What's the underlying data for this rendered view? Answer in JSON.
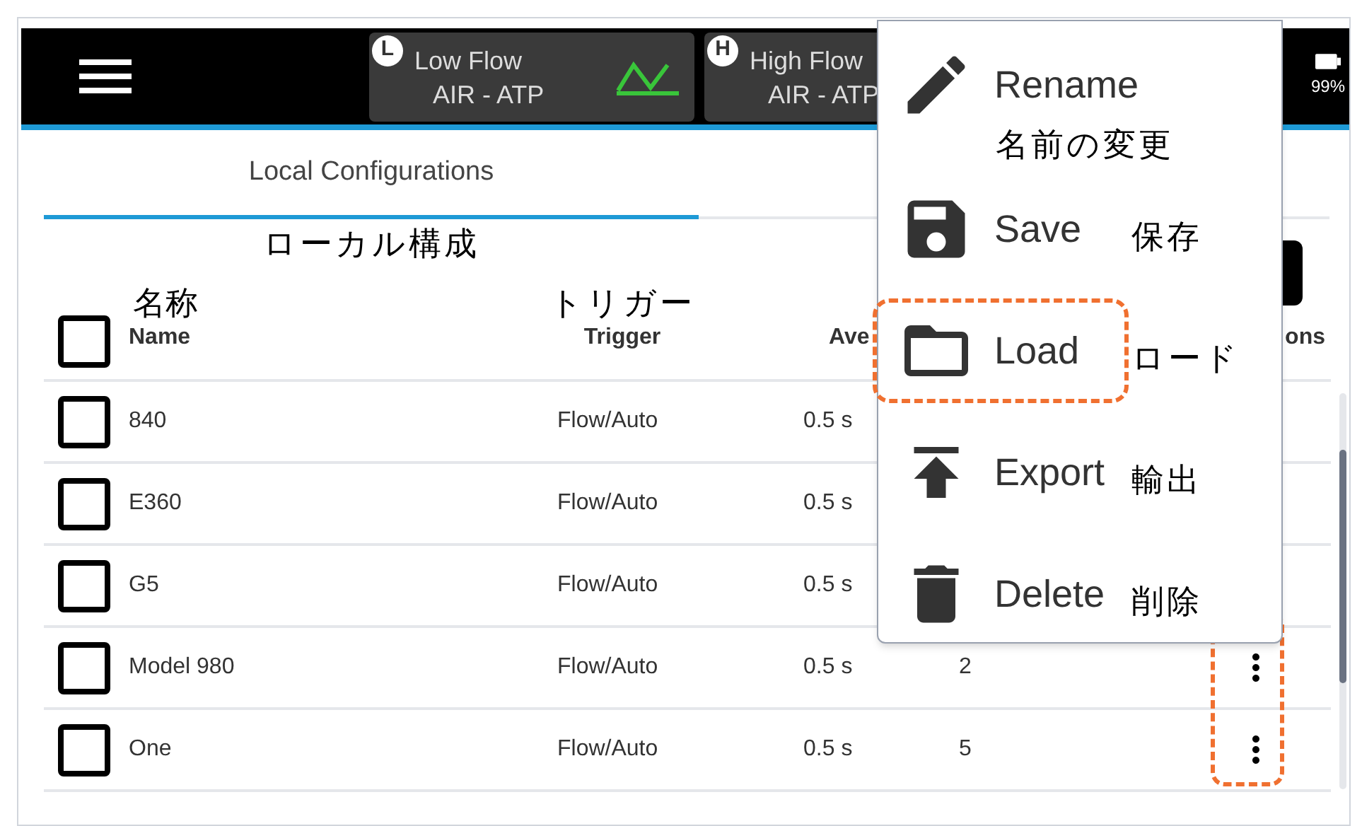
{
  "header": {
    "sensors": [
      {
        "badge": "L",
        "name": "Low Flow",
        "gas": "AIR - ATP",
        "waveform": true
      },
      {
        "badge": "H",
        "name": "High Flow",
        "gas": "AIR - ATP",
        "waveform": false
      }
    ],
    "battery": "99%"
  },
  "tabs": [
    {
      "label": "Local Configurations",
      "annotation": "ローカル構成",
      "selected": true
    }
  ],
  "table": {
    "columns": [
      {
        "label": "Name",
        "annotation": "名称"
      },
      {
        "label": "Trigger",
        "annotation": "トリガー"
      },
      {
        "label": "Ave"
      },
      {
        "label": "ons"
      }
    ],
    "header_checked": false,
    "rows": [
      {
        "name": "840",
        "trigger": "Flow/Auto",
        "average": "0.5 s",
        "checked": false,
        "menu_button": false,
        "highlighted": false
      },
      {
        "name": "E360",
        "trigger": "Flow/Auto",
        "average": "0.5 s",
        "checked": false,
        "menu_button": false,
        "highlighted": false
      },
      {
        "name": "G5",
        "trigger": "Flow/Auto",
        "average": "0.5 s",
        "checked": false,
        "menu_button": false,
        "highlighted": false
      },
      {
        "name": "Model 980",
        "trigger": "Flow/Auto",
        "average": "0.5 s",
        "column_4": "2",
        "checked": false,
        "menu_button": true,
        "highlighted": true
      },
      {
        "name": "One",
        "trigger": "Flow/Auto",
        "average": "0.5 s",
        "column_4": "5",
        "checked": false,
        "menu_button": true,
        "highlighted": true
      }
    ]
  },
  "menu": {
    "items": [
      {
        "kind": "rename",
        "label": "Rename",
        "annotation": "名前の変更",
        "highlighted": false
      },
      {
        "kind": "save",
        "label": "Save",
        "annotation": "保存",
        "highlighted": false
      },
      {
        "kind": "load",
        "label": "Load",
        "annotation": "ロード",
        "highlighted": true
      },
      {
        "kind": "export",
        "label": "Export",
        "annotation": "輸出",
        "highlighted": false
      },
      {
        "kind": "delete",
        "label": "Delete",
        "annotation": "削除",
        "highlighted": false
      }
    ]
  }
}
